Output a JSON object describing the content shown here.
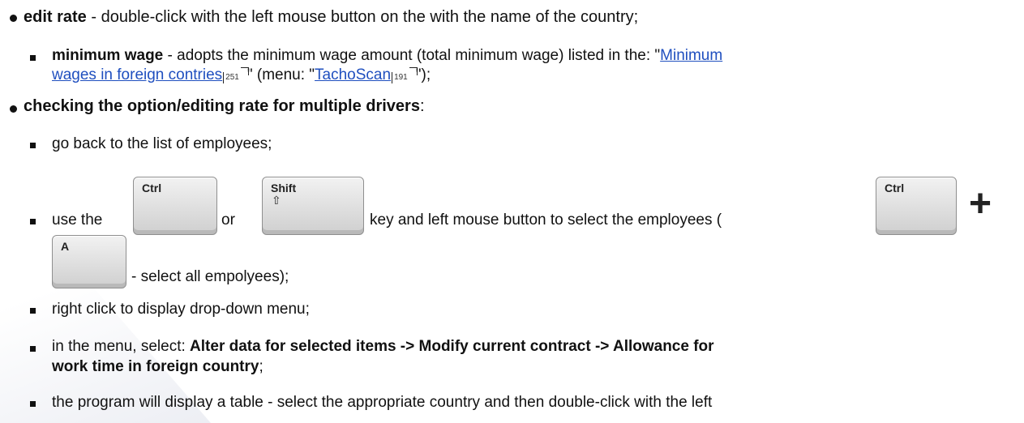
{
  "items": {
    "edit_rate": {
      "title": "edit rate",
      "desc": " - double-click with the left mouse button on the with the name of the country;"
    },
    "min_wage": {
      "title": "minimum wage",
      "line1_pre": " - adopts the minimum wage amount (total minimum wage) listed in the: \"",
      "link1a": "Minimum",
      "link1b": "wages in foreign contries",
      "ref1": "251",
      "mid": "\" (menu: \"",
      "link2": "TachoScan",
      "ref2": "191",
      "end": "\");"
    },
    "multi": {
      "title": "checking the option/editing rate for multiple drivers",
      "colon": ":"
    },
    "go_back": "go back to the list of employees;",
    "use_keys": {
      "pre": "use the",
      "or": "or",
      "post": "key and left mouse button to select the employees (",
      "select_all": "- select all empolyees);"
    },
    "right_click": "right click to display drop-down menu;",
    "menu_select": {
      "pre": "in the menu, select: ",
      "path1": "Alter data for selected items -> Modify current contract -> Allowance for",
      "path2": "work time in foreign country",
      "end": ";"
    },
    "table": "the program will display a table - select the appropriate country and then double-click with the left"
  },
  "keys": {
    "ctrl": "Ctrl",
    "shift": "Shift",
    "a": "A",
    "shift_arrow": "⇧",
    "plus": "+"
  }
}
